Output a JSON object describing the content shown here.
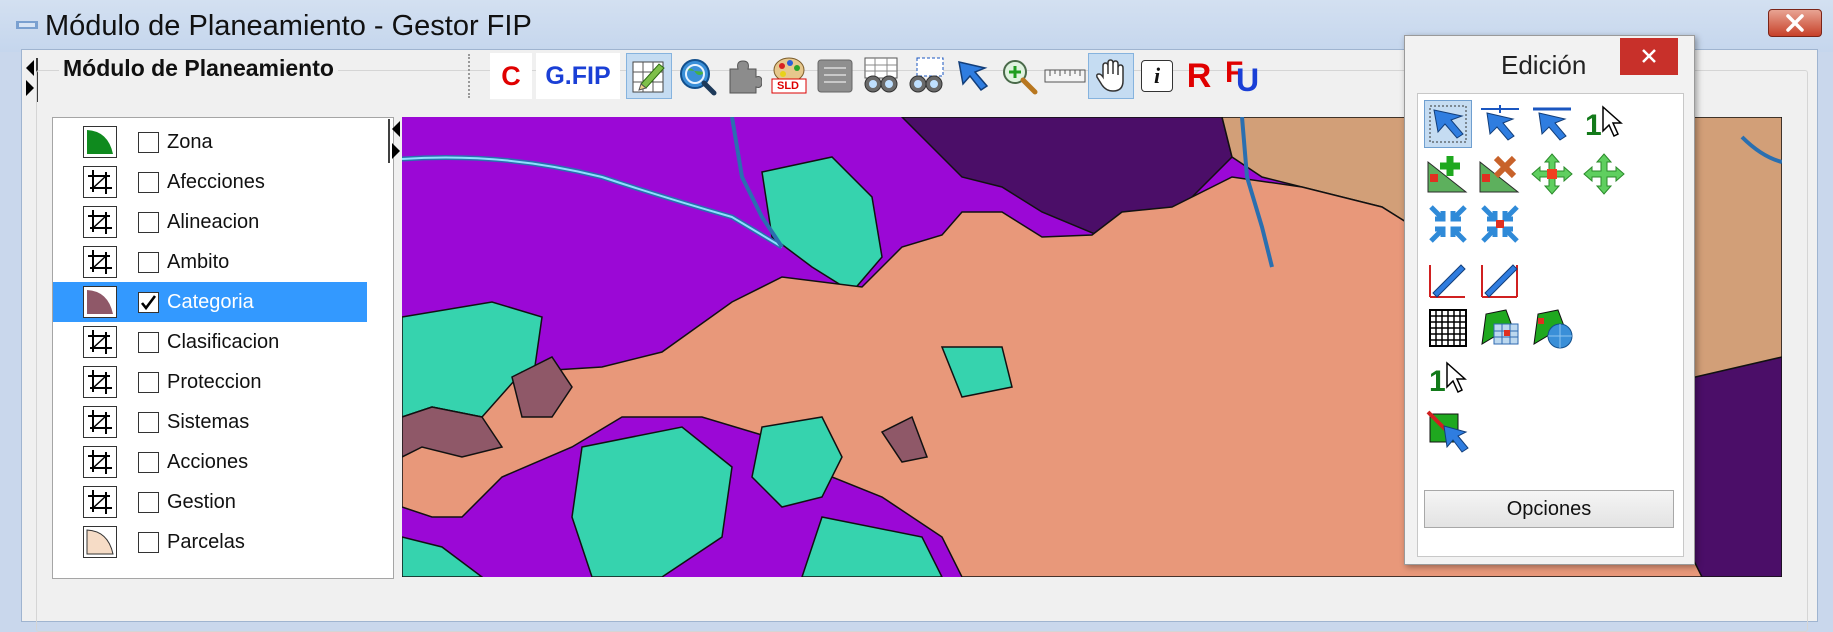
{
  "window": {
    "title": "Módulo de Planeamiento - Gestor FIP"
  },
  "group": {
    "title": "Módulo de Planeamiento"
  },
  "toolbar": {
    "items": [
      {
        "icon": "c-text-icon",
        "text": "C",
        "color": "#e00000"
      },
      {
        "icon": "gfip-text-icon",
        "text": "G.FIP",
        "color": "#1a3fd6"
      },
      {
        "icon": "edit-grid-icon",
        "active": true
      },
      {
        "icon": "globe-search-icon"
      },
      {
        "icon": "puzzle-icon"
      },
      {
        "icon": "sld-palette-icon",
        "text": "SLD"
      },
      {
        "icon": "list-icon"
      },
      {
        "icon": "binoculars-icon"
      },
      {
        "icon": "binoculars-select-icon"
      },
      {
        "icon": "select-arrow-icon"
      },
      {
        "icon": "zoom-in-icon"
      },
      {
        "icon": "ruler-icon"
      },
      {
        "icon": "pan-hand-icon",
        "active": true
      },
      {
        "icon": "info-icon",
        "text": "i"
      },
      {
        "icon": "r-text-icon",
        "text": "R",
        "color": "#e00000"
      },
      {
        "icon": "fu-text-icon",
        "text_f": "F",
        "text_u": "U"
      }
    ]
  },
  "layers": [
    {
      "label": "Zona",
      "checked": false,
      "symbol": "green-polygon"
    },
    {
      "label": "Afecciones",
      "checked": false,
      "symbol": "crosshair"
    },
    {
      "label": "Alineacion",
      "checked": false,
      "symbol": "crosshair"
    },
    {
      "label": "Ambito",
      "checked": false,
      "symbol": "crosshair"
    },
    {
      "label": "Categoria",
      "checked": true,
      "selected": true,
      "symbol": "mauve-polygon"
    },
    {
      "label": "Clasificacion",
      "checked": false,
      "symbol": "crosshair"
    },
    {
      "label": "Proteccion",
      "checked": false,
      "symbol": "crosshair"
    },
    {
      "label": "Sistemas",
      "checked": false,
      "symbol": "crosshair"
    },
    {
      "label": "Acciones",
      "checked": false,
      "symbol": "crosshair"
    },
    {
      "label": "Gestion",
      "checked": false,
      "symbol": "crosshair"
    },
    {
      "label": "Parcelas",
      "checked": false,
      "symbol": "peach-polygon"
    }
  ],
  "map": {
    "colors": {
      "purple": "#9b08d6",
      "dark_purple": "#4b0e68",
      "salmon": "#e8987a",
      "teal": "#36d3ae",
      "mauve": "#8f5868",
      "tan": "#d29f78",
      "river": "#2a6fb0"
    }
  },
  "edit_panel": {
    "title": "Edición",
    "options_label": "Opciones",
    "numeral_label": "1",
    "tools": [
      "select-arrow-icon",
      "select-vertex-icon",
      "select-edge-icon",
      "select-one-icon",
      "add-vertex-icon",
      "delete-vertex-icon",
      "move-vertex-icon",
      "move-icon",
      "collapse-icon",
      "split-icon",
      "draw-line-icon",
      "cut-line-icon",
      "grid-icon",
      "polygon-map-icon",
      "polygon-globe-icon",
      "select-one-small-icon",
      "erase-select-icon"
    ]
  }
}
